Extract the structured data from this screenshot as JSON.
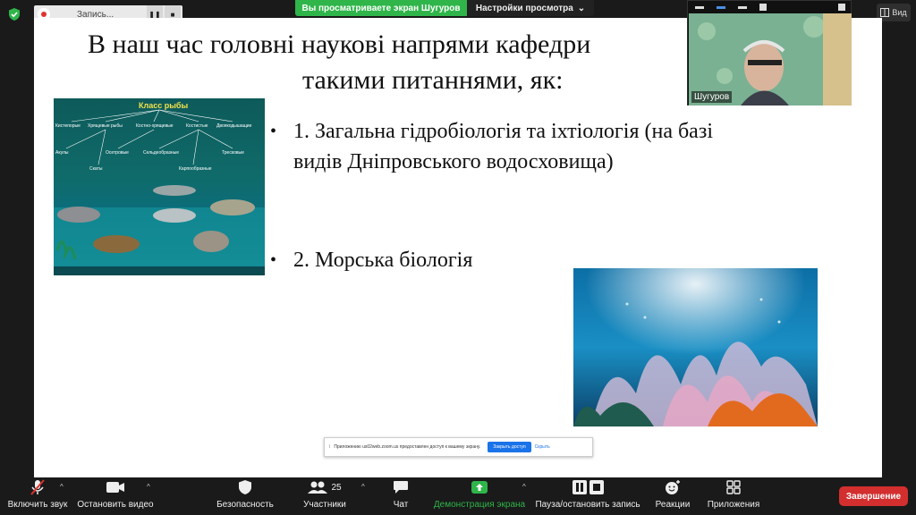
{
  "recording": {
    "label": "Запись..."
  },
  "banner": {
    "viewing_text": "Вы просматриваете экран Шугуров",
    "view_settings_label": "Настройки просмотра"
  },
  "view_button": {
    "label": "Вид"
  },
  "slide": {
    "title_line1": "В наш час головні наукові напрями кафедри",
    "title_line2": "такими питаннями, як:",
    "bullet1_line1": "1. Загальна гідробіологія та іхтіологія (на базі",
    "bullet1_line2": "видів Дніпровського водосховища)",
    "bullet2": "2. Морська біологія",
    "bullet_symbol": "•",
    "fish_image": {
      "title": "Класс рыбы",
      "labels": [
        "Кистепорые",
        "Хрящевые рыбы",
        "Костно-хрящевые",
        "Костистые",
        "Двоякодышащие",
        "Акулы",
        "Осетровые",
        "Сельдеобразные",
        "Тресковые",
        "Скаты",
        "Карпообразные"
      ]
    }
  },
  "camera": {
    "name": "Шугуров"
  },
  "notice": {
    "text": "Приложению us02web.zoom.us предоставлен доступ к вашему экрану.",
    "close_access": "Закрыть доступ",
    "hide": "Скрыть"
  },
  "toolbar": {
    "unmute": "Включить звук",
    "stop_video": "Остановить видео",
    "security": "Безопасность",
    "participants": "Участники",
    "participants_count": "25",
    "chat": "Чат",
    "share_screen": "Демонстрация экрана",
    "pause_recording": "Пауза/остановить запись",
    "reactions": "Реакции",
    "apps": "Приложения",
    "end": "Завершение"
  },
  "colors": {
    "share_green": "#2fb54a",
    "end_red": "#d32f2f",
    "toolbar_bg": "#1a1a1a"
  }
}
